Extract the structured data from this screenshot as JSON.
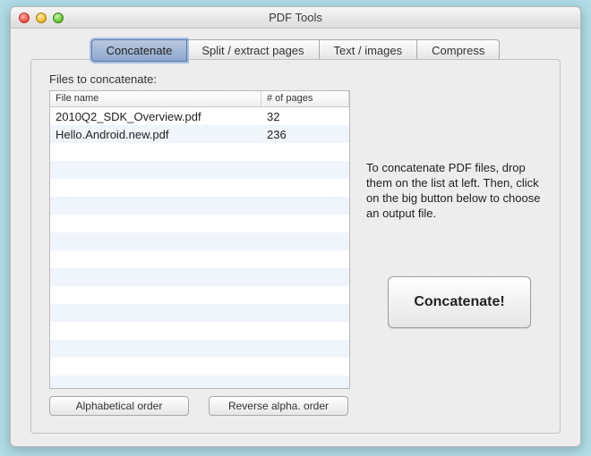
{
  "window": {
    "title": "PDF Tools"
  },
  "tabs": [
    {
      "label": "Concatenate",
      "active": true
    },
    {
      "label": "Split / extract pages",
      "active": false
    },
    {
      "label": "Text / images",
      "active": false
    },
    {
      "label": "Compress",
      "active": false
    }
  ],
  "list_label": "Files to concatenate:",
  "columns": {
    "name": "File name",
    "pages": "# of pages"
  },
  "files": [
    {
      "name": "2010Q2_SDK_Overview.pdf",
      "pages": "32"
    },
    {
      "name": "Hello.Android.new.pdf",
      "pages": "236"
    }
  ],
  "empty_row_count": 14,
  "sort_buttons": {
    "alpha": "Alphabetical order",
    "reverse": "Reverse alpha. order"
  },
  "instructions": "To concatenate PDF files, drop them on the list at left. Then, click on the big button below to choose an output file.",
  "big_button": "Concatenate!"
}
